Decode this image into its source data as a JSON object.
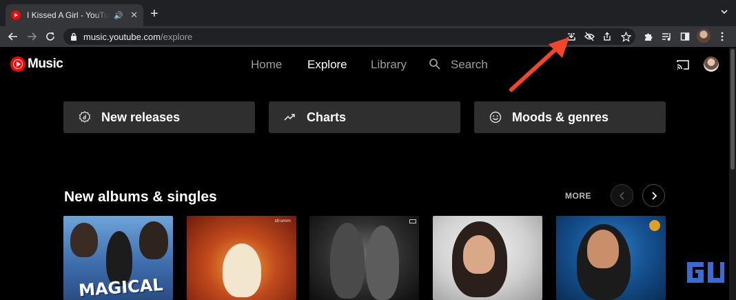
{
  "browser": {
    "tab": {
      "title": "I Kissed A Girl - YouTube Music",
      "close_label": "✕"
    },
    "new_tab_label": "+",
    "url": {
      "host": "music.youtube.com",
      "path": "/explore"
    },
    "icons": {
      "back": "arrow-left-icon",
      "forward": "arrow-right-icon",
      "reload": "reload-icon",
      "install": "install-app-icon",
      "tracking": "eye-slash-icon",
      "share": "share-icon",
      "bookmark": "star-icon",
      "extensions": "puzzle-icon",
      "media": "media-queue-icon",
      "sidepanel": "side-panel-icon",
      "menu": "kebab-menu-icon"
    }
  },
  "ytmusic": {
    "logo_text": "Music",
    "nav": {
      "home": "Home",
      "explore": "Explore",
      "library": "Library",
      "search": "Search"
    },
    "chips": [
      {
        "label": "New releases",
        "icon": "new-releases-icon"
      },
      {
        "label": "Charts",
        "icon": "trending-icon"
      },
      {
        "label": "Moods & genres",
        "icon": "smiley-icon"
      }
    ],
    "section": {
      "title": "New albums & singles",
      "more_label": "MORE"
    },
    "albums": [
      {
        "art_caption": "MAGICAL"
      },
      {
        "art_label": "strumm"
      },
      {
        "art_label": ""
      },
      {
        "art_label": ""
      },
      {
        "art_label": ""
      }
    ]
  },
  "colors": {
    "brand_red": "#ff0000",
    "annotation_arrow": "#f2462b",
    "chip_bg": "#2f2f2f",
    "chrome_dark": "#202124",
    "chrome_toolbar": "#35363a"
  }
}
